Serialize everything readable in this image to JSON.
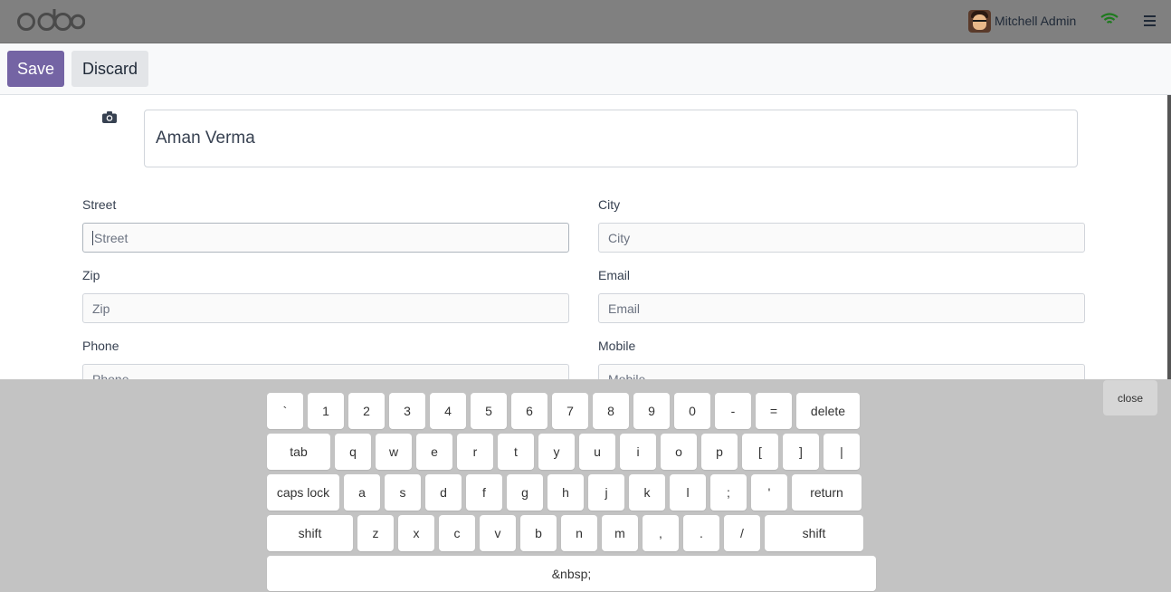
{
  "header": {
    "logo": "odoo",
    "user_name": "Mitchell Admin",
    "icons": [
      "avatar",
      "wifi-icon",
      "hamburger-menu-icon"
    ]
  },
  "toolbar": {
    "save_label": "Save",
    "discard_label": "Discard"
  },
  "form": {
    "name_value": "Aman Verma",
    "street_label": "Street",
    "street_placeholder": "Street",
    "city_label": "City",
    "city_placeholder": "City",
    "zip_label": "Zip",
    "zip_placeholder": "Zip",
    "email_label": "Email",
    "email_placeholder": "Email",
    "phone_label": "Phone",
    "phone_placeholder": "Phone",
    "mobile_label": "Mobile",
    "mobile_placeholder": "Mobile"
  },
  "keyboard": {
    "close_label": "close",
    "rows": [
      [
        "`",
        "1",
        "2",
        "3",
        "4",
        "5",
        "6",
        "7",
        "8",
        "9",
        "0",
        "-",
        "=",
        "delete"
      ],
      [
        "tab",
        "q",
        "w",
        "e",
        "r",
        "t",
        "y",
        "u",
        "i",
        "o",
        "p",
        "[",
        "]",
        "|"
      ],
      [
        "caps lock",
        "a",
        "s",
        "d",
        "f",
        "g",
        "h",
        "j",
        "k",
        "l",
        ";",
        "'",
        "return"
      ],
      [
        "shift",
        "z",
        "x",
        "c",
        "v",
        "b",
        "n",
        "m",
        ",",
        ".",
        "/",
        "shift"
      ],
      [
        "&nbsp;"
      ]
    ]
  },
  "colors": {
    "navbar": "#808080",
    "primary": "#7464a4",
    "keyboard_bg": "#c3c3c3"
  }
}
